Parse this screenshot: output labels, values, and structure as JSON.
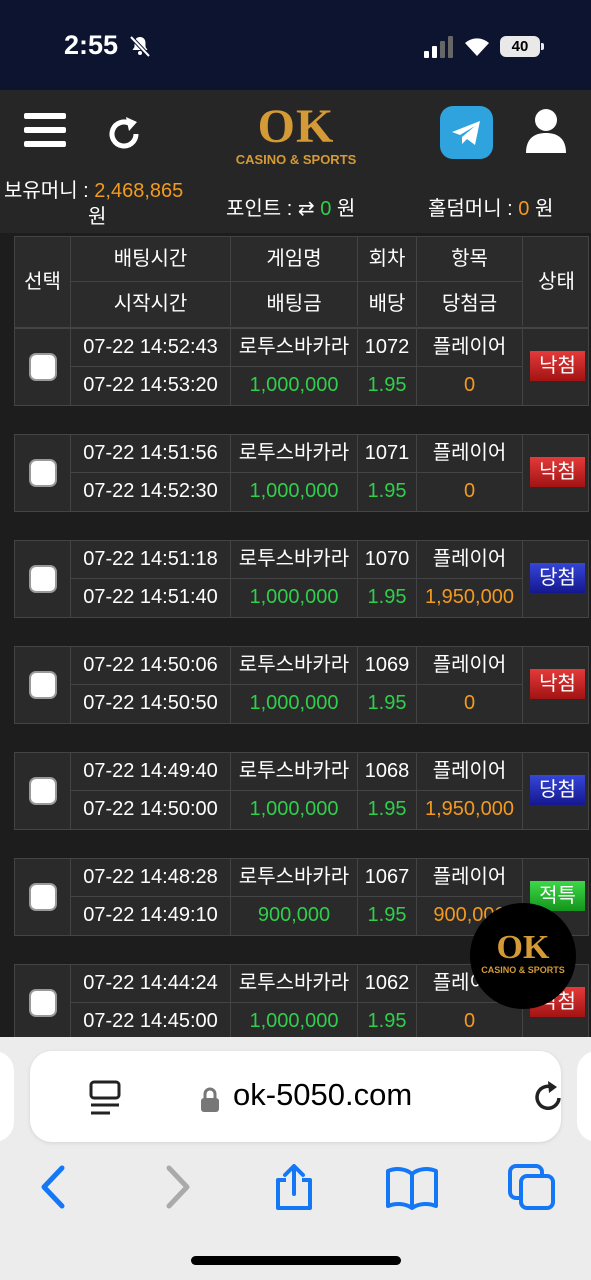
{
  "status_bar": {
    "time": "2:55",
    "battery": "40"
  },
  "header": {
    "logo_main": "OK",
    "logo_sub": "CASINO & SPORTS",
    "money_label": "보유머니 :",
    "money_value": "2,468,865",
    "money_unit": "원",
    "point_label": "포인트 :",
    "point_value": "0",
    "point_unit": "원",
    "hold_label": "홀덤머니 :",
    "hold_value": "0",
    "hold_unit": "원"
  },
  "table": {
    "headers": {
      "select": "선택",
      "bet_time": "배팅시간",
      "start_time": "시작시간",
      "game_name": "게임명",
      "bet_amount": "배팅금",
      "round": "회차",
      "odds": "배당",
      "item": "항목",
      "prize": "당첨금",
      "status": "상태"
    },
    "rows": [
      {
        "bet_time": "07-22 14:52:43",
        "start_time": "07-22 14:53:20",
        "game": "로투스바카라",
        "amount": "1,000,000",
        "round": "1072",
        "odds": "1.95",
        "item": "플레이어",
        "prize": "0",
        "status": "낙첨",
        "status_type": "lose"
      },
      {
        "bet_time": "07-22 14:51:56",
        "start_time": "07-22 14:52:30",
        "game": "로투스바카라",
        "amount": "1,000,000",
        "round": "1071",
        "odds": "1.95",
        "item": "플레이어",
        "prize": "0",
        "status": "낙첨",
        "status_type": "lose"
      },
      {
        "bet_time": "07-22 14:51:18",
        "start_time": "07-22 14:51:40",
        "game": "로투스바카라",
        "amount": "1,000,000",
        "round": "1070",
        "odds": "1.95",
        "item": "플레이어",
        "prize": "1,950,000",
        "status": "당첨",
        "status_type": "win"
      },
      {
        "bet_time": "07-22 14:50:06",
        "start_time": "07-22 14:50:50",
        "game": "로투스바카라",
        "amount": "1,000,000",
        "round": "1069",
        "odds": "1.95",
        "item": "플레이어",
        "prize": "0",
        "status": "낙첨",
        "status_type": "lose"
      },
      {
        "bet_time": "07-22 14:49:40",
        "start_time": "07-22 14:50:00",
        "game": "로투스바카라",
        "amount": "1,000,000",
        "round": "1068",
        "odds": "1.95",
        "item": "플레이어",
        "prize": "1,950,000",
        "status": "당첨",
        "status_type": "win"
      },
      {
        "bet_time": "07-22 14:48:28",
        "start_time": "07-22 14:49:10",
        "game": "로투스바카라",
        "amount": "900,000",
        "round": "1067",
        "odds": "1.95",
        "item": "플레이어",
        "prize": "900,000",
        "status": "적특",
        "status_type": "special"
      },
      {
        "bet_time": "07-22 14:44:24",
        "start_time": "07-22 14:45:00",
        "game": "로투스바카라",
        "amount": "1,000,000",
        "round": "1062",
        "odds": "1.95",
        "item": "플레이어",
        "prize": "0",
        "status": "낙첨",
        "status_type": "lose"
      }
    ]
  },
  "browser": {
    "url": "ok-5050.com"
  },
  "colors": {
    "accent_gold": "#d49a36",
    "money_orange": "#f39a1f",
    "odds_green": "#2fcf4b",
    "lose_red": "#c62222",
    "win_blue": "#2230b8",
    "special_green": "#22b52e"
  }
}
